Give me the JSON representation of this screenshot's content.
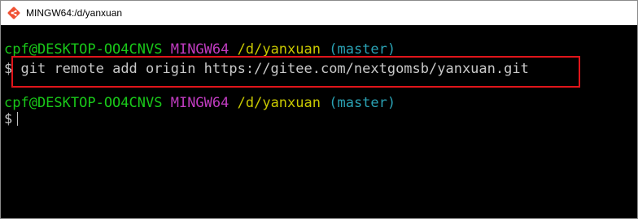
{
  "window": {
    "title": "MINGW64:/d/yanxuan",
    "icon": "git-bash-icon"
  },
  "terminal": {
    "prompt1": {
      "user_host": "cpf@DESKTOP-OO4CNVS",
      "shell": "MINGW64",
      "path": "/d/yanxuan",
      "branch": "(master)"
    },
    "command_line": {
      "symbol": "$",
      "command": "git remote add origin https://gitee.com/nextgomsb/yanxuan.git"
    },
    "prompt2": {
      "user_host": "cpf@DESKTOP-OO4CNVS",
      "shell": "MINGW64",
      "path": "/d/yanxuan",
      "branch": "(master)"
    },
    "current_line": {
      "symbol": "$"
    }
  },
  "colors": {
    "user_host": "#19c819",
    "shell": "#c03cc0",
    "path": "#c8c800",
    "branch": "#2aa1b3",
    "highlight_border": "#e0151a",
    "background": "#000000"
  }
}
